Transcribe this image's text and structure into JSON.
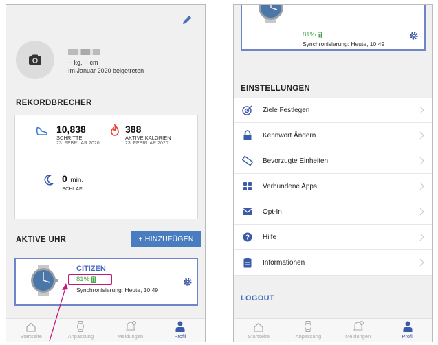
{
  "left_screen": {
    "profile": {
      "stats": "-- kg, -- cm",
      "joined": "Im Januar 2020  beigetreten"
    },
    "records": {
      "title": "REKORDBRECHER",
      "items": [
        {
          "value": "10,838",
          "unit": "",
          "label": "SCHRITTE",
          "date": "23. FEBRUAR 2020"
        },
        {
          "value": "388",
          "unit": "",
          "label": "AKTIVE KALORIEN",
          "date": "23. FEBRUAR 2020"
        },
        {
          "value": "0",
          "unit": "min.",
          "label": "SCHLAF",
          "date": ""
        }
      ]
    },
    "active_watch": {
      "title": "AKTIVE UHR",
      "add_button": "+ HINZUFÜGEN",
      "watch": {
        "name": "CITIZEN",
        "battery": "81%",
        "sync": "Synchronisierung: Heute, 10:49"
      }
    }
  },
  "right_screen": {
    "watch": {
      "battery": "81%",
      "sync": "Synchronisierung: Heute, 10:49"
    },
    "settings": {
      "title": "EINSTELLUNGEN",
      "items": [
        {
          "label": "Ziele Festlegen",
          "icon": "target-icon"
        },
        {
          "label": "Kennwort Ändern",
          "icon": "lock-icon"
        },
        {
          "label": "Bevorzugte Einheiten",
          "icon": "ruler-icon"
        },
        {
          "label": "Verbundene Apps",
          "icon": "apps-grid-icon"
        },
        {
          "label": "Opt-In",
          "icon": "mail-icon"
        },
        {
          "label": "Hilfe",
          "icon": "help-icon"
        },
        {
          "label": "Informationen",
          "icon": "clipboard-icon"
        }
      ]
    },
    "logout": "LOGOUT"
  },
  "nav": {
    "items": [
      {
        "label": "Startseite",
        "icon": "home-icon",
        "active": false
      },
      {
        "label": "Anpassung",
        "icon": "watch-icon",
        "active": false
      },
      {
        "label": "Meldungen",
        "icon": "bell-icon",
        "active": false
      },
      {
        "label": "Profil",
        "icon": "person-icon",
        "active": true
      }
    ]
  },
  "colors": {
    "accent": "#4a6cc0",
    "button": "#4a7cc0",
    "highlight": "#c2187a",
    "battery": "#4aa84a",
    "calorie": "#e8463c"
  }
}
